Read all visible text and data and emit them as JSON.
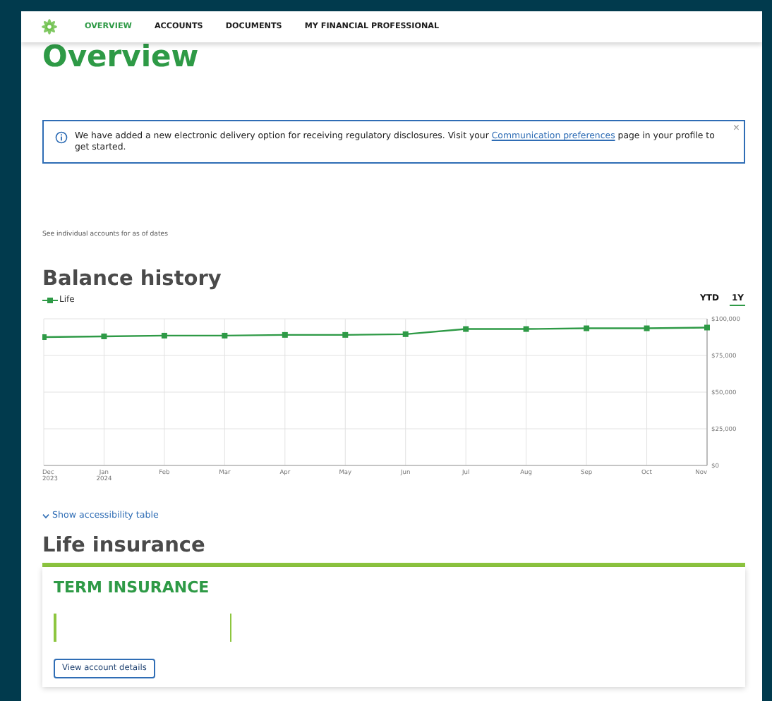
{
  "nav": {
    "items": [
      {
        "label": "OVERVIEW",
        "selected": true
      },
      {
        "label": "ACCOUNTS",
        "selected": false
      },
      {
        "label": "DOCUMENTS",
        "selected": false
      },
      {
        "label": "MY FINANCIAL PROFESSIONAL",
        "selected": false
      }
    ]
  },
  "page_title": "Overview",
  "alert": {
    "text_before": "We have added a new electronic delivery option for receiving regulatory disclosures. Visit your",
    "link": "Communication preferences",
    "text_after": "page in your profile to get started.",
    "close": "×"
  },
  "as_of_note": "See individual accounts for as of dates",
  "balance_history": {
    "title": "Balance history",
    "ranges": [
      {
        "label": "YTD",
        "selected": false
      },
      {
        "label": "1Y",
        "selected": true
      }
    ],
    "chart_data": {
      "type": "line",
      "categories": [
        "Dec 2023",
        "Jan 2024",
        "Feb",
        "Mar",
        "Apr",
        "May",
        "Jun",
        "Jul",
        "Aug",
        "Sep",
        "Oct",
        "Nov"
      ],
      "ylim": [
        0,
        100000
      ],
      "grid": true,
      "yticks": [
        {
          "value": 0,
          "label": "$0"
        },
        {
          "value": 25000,
          "label": "$25,000"
        },
        {
          "value": 50000,
          "label": "$50,000"
        },
        {
          "value": 75000,
          "label": "$75,000"
        },
        {
          "value": 100000,
          "label": "$100,000"
        }
      ],
      "series": [
        {
          "name": "Life",
          "color": "#2e9a46",
          "marker": "square",
          "values": [
            87500,
            88000,
            88500,
            88500,
            89000,
            89000,
            89500,
            93000,
            93000,
            93500,
            93500,
            94000
          ]
        }
      ]
    },
    "accessibility_link": "Show accessibility table"
  },
  "life_insurance": {
    "title": "Life insurance",
    "card": {
      "title": "TERM INSURANCE",
      "button": "View account details"
    }
  }
}
